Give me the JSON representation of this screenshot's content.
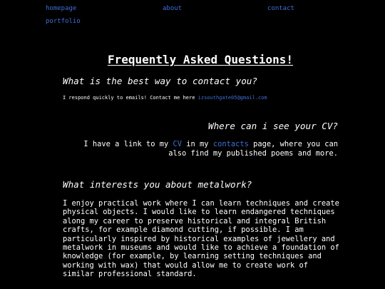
{
  "nav": {
    "homepage": "homepage",
    "about": "about",
    "contact": "contact",
    "portfolio": "portfolio"
  },
  "title": "Frequently Asked Questions!",
  "faq": [
    {
      "question": "What is the best way to contact you?",
      "answer_prefix": "I respond quickly to emails! Contact me here ",
      "email": "izsouthgate05@gmail.com"
    },
    {
      "question": "Where can i see your CV?",
      "answer_part1": "I have a link to my ",
      "cv_link": "CV",
      "answer_part2": " in my ",
      "contacts_link": "contacts",
      "answer_part3": " page, where you can also find my published poems and more."
    },
    {
      "question": "What interests you about metalwork?",
      "answer": "I enjoy practical work where I can learn techniques and create physical objects. I would like to learn endangered techniques along my career to preserve historical and integral British crafts, for example diamond cutting, if possible. I am particularly inspired by historical examples of jewellery and metalwork in museums and would like to achieve a foundation of knowledge (for example, by learning setting techniques and working with wax) that would allow me to create work of similar professional standard."
    }
  ],
  "colors": {
    "background": "#000000",
    "text": "#ffffff",
    "link": "#3f6fd8"
  }
}
